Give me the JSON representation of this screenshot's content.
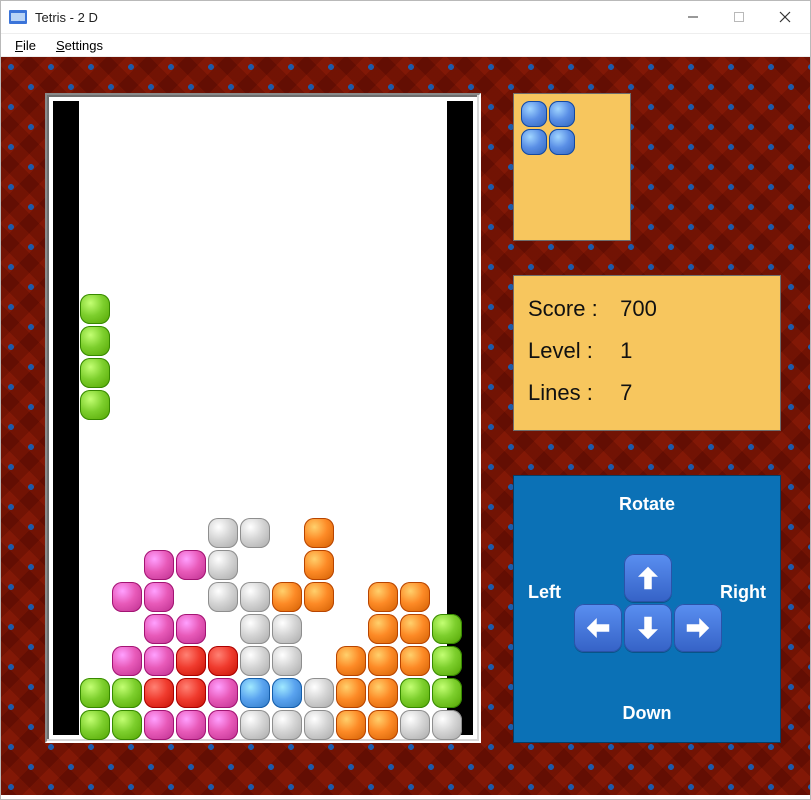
{
  "window": {
    "title": "Tetris - 2 D"
  },
  "menu": {
    "file": "File",
    "settings": "Settings"
  },
  "board": {
    "cols": 12,
    "rows": 20,
    "cell": 32,
    "falling": {
      "color": "#7dcf2d",
      "cells": [
        [
          0,
          6
        ],
        [
          0,
          7
        ],
        [
          0,
          8
        ],
        [
          0,
          9
        ]
      ]
    },
    "stack": [
      {
        "color": "#e85ab9",
        "cells": [
          [
            2,
            14
          ],
          [
            3,
            14
          ],
          [
            1,
            15
          ],
          [
            2,
            15
          ]
        ]
      },
      {
        "color": "#d4d4d4",
        "cells": [
          [
            4,
            13
          ],
          [
            5,
            13
          ],
          [
            4,
            14
          ],
          [
            4,
            15
          ]
        ]
      },
      {
        "color": "#fd8a26",
        "cells": [
          [
            6,
            15
          ],
          [
            7,
            15
          ],
          [
            7,
            14
          ],
          [
            7,
            13
          ]
        ]
      },
      {
        "color": "#d4d4d4",
        "cells": [
          [
            5,
            15
          ],
          [
            5,
            16
          ]
        ]
      },
      {
        "color": "#e85ab9",
        "cells": [
          [
            1,
            17
          ],
          [
            2,
            17
          ],
          [
            2,
            16
          ],
          [
            3,
            16
          ]
        ]
      },
      {
        "color": "#f03b2e",
        "cells": [
          [
            2,
            18
          ],
          [
            3,
            18
          ],
          [
            3,
            17
          ],
          [
            4,
            17
          ]
        ]
      },
      {
        "color": "#fd8a26",
        "cells": [
          [
            9,
            15
          ],
          [
            10,
            15
          ],
          [
            10,
            16
          ],
          [
            10,
            17
          ]
        ]
      },
      {
        "color": "#fd8a26",
        "cells": [
          [
            8,
            17
          ],
          [
            9,
            17
          ],
          [
            9,
            16
          ],
          [
            9,
            18
          ]
        ]
      },
      {
        "color": "#7dcf2d",
        "cells": [
          [
            10,
            18
          ],
          [
            11,
            18
          ],
          [
            11,
            17
          ],
          [
            11,
            16
          ]
        ]
      },
      {
        "color": "#7dcf2d",
        "cells": [
          [
            0,
            19
          ],
          [
            1,
            19
          ],
          [
            1,
            18
          ],
          [
            0,
            18
          ]
        ]
      },
      {
        "color": "#e85ab9",
        "cells": [
          [
            2,
            19
          ],
          [
            3,
            19
          ],
          [
            4,
            19
          ],
          [
            4,
            18
          ]
        ]
      },
      {
        "color": "#5aa3ef",
        "cells": [
          [
            5,
            18
          ],
          [
            6,
            18
          ]
        ]
      },
      {
        "color": "#d4d4d4",
        "cells": [
          [
            5,
            19
          ],
          [
            6,
            19
          ],
          [
            7,
            19
          ],
          [
            7,
            18
          ]
        ]
      },
      {
        "color": "#fd8a26",
        "cells": [
          [
            8,
            19
          ],
          [
            9,
            19
          ],
          [
            8,
            18
          ]
        ]
      },
      {
        "color": "#d4d4d4",
        "cells": [
          [
            10,
            19
          ],
          [
            11,
            19
          ]
        ]
      },
      {
        "color": "#d4d4d4",
        "cells": [
          [
            5,
            17
          ],
          [
            6,
            17
          ],
          [
            6,
            16
          ]
        ]
      }
    ]
  },
  "next_piece": {
    "color": "#5a8fe6",
    "cells": [
      [
        0,
        0
      ],
      [
        1,
        0
      ],
      [
        0,
        1
      ],
      [
        1,
        1
      ]
    ],
    "cell": 28
  },
  "stats": {
    "score_label": "Score :",
    "score_value": "700",
    "level_label": "Level :",
    "level_value": "1",
    "lines_label": "Lines :",
    "lines_value": "7"
  },
  "controls": {
    "rotate": "Rotate",
    "left": "Left",
    "right": "Right",
    "down": "Down"
  }
}
